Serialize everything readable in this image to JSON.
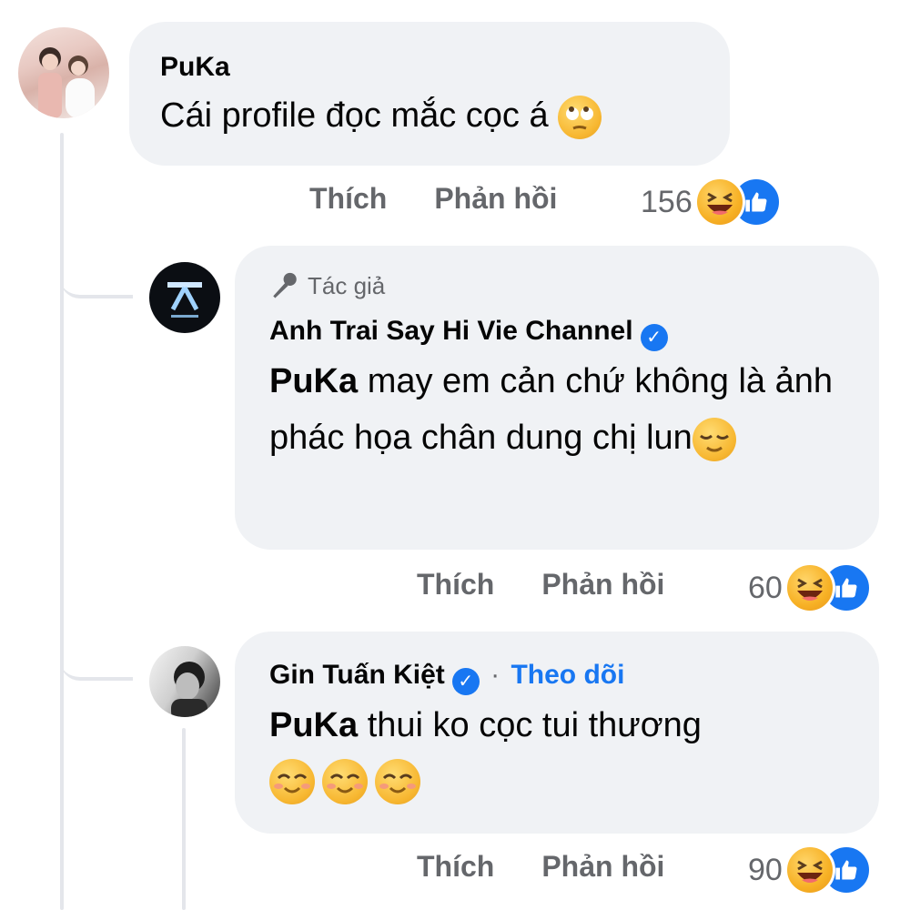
{
  "comments": [
    {
      "author": "PuKa",
      "text": "Cái profile đọc mắc cọc á",
      "emoji_icon": "rolling-eyes-emoji",
      "actions": {
        "like": "Thích",
        "reply": "Phản hồi"
      },
      "reaction_count": "156",
      "reaction_icons": [
        "haha-reaction-icon",
        "like-reaction-icon"
      ]
    },
    {
      "badge": "Tác giả",
      "badge_icon": "microphone-icon",
      "author": "Anh Trai Say Hi Vie Channel",
      "verified": true,
      "mention": "PuKa",
      "text": "may em cản chứ không là ảnh phác họa chân dung chị lun",
      "emoji_icon": "relieved-face-emoji",
      "actions": {
        "like": "Thích",
        "reply": "Phản hồi"
      },
      "reaction_count": "60",
      "reaction_icons": [
        "haha-reaction-icon",
        "like-reaction-icon"
      ]
    },
    {
      "author": "Gin Tuấn Kiệt",
      "verified": true,
      "separator": "·",
      "follow_label": "Theo dõi",
      "mention": "PuKa",
      "text": "thui ko cọc tui thương",
      "emoji_icons": [
        "smiling-blush-emoji",
        "smiling-blush-emoji",
        "smiling-blush-emoji"
      ],
      "actions": {
        "like": "Thích",
        "reply": "Phản hồi"
      },
      "reaction_count": "90",
      "reaction_icons": [
        "haha-reaction-icon",
        "like-reaction-icon"
      ]
    }
  ],
  "colors": {
    "bubble": "#f0f2f5",
    "secondary_text": "#65676b",
    "link": "#1877f2",
    "thread_line": "#e4e6eb"
  }
}
